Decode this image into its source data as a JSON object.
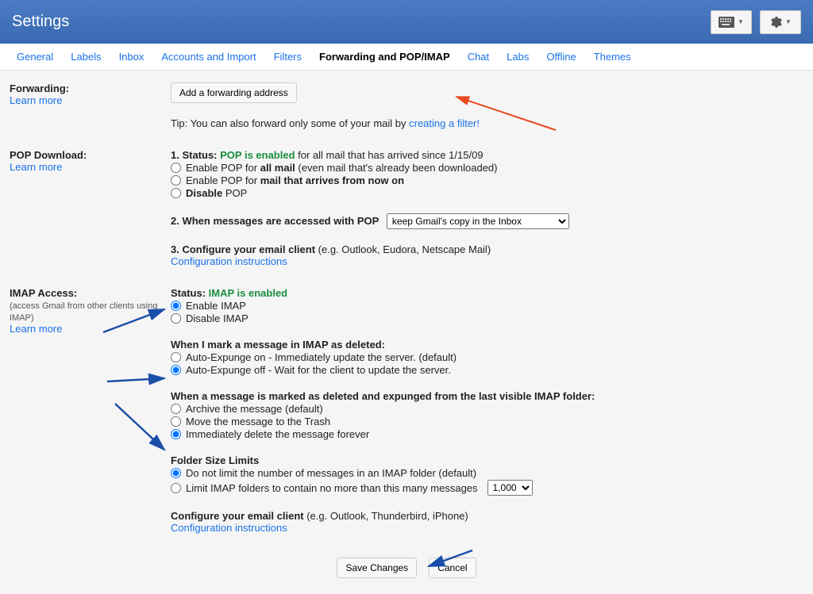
{
  "header": {
    "title": "Settings"
  },
  "tabs": [
    {
      "label": "General"
    },
    {
      "label": "Labels"
    },
    {
      "label": "Inbox"
    },
    {
      "label": "Accounts and Import"
    },
    {
      "label": "Filters"
    },
    {
      "label": "Forwarding and POP/IMAP",
      "active": true
    },
    {
      "label": "Chat"
    },
    {
      "label": "Labs"
    },
    {
      "label": "Offline"
    },
    {
      "label": "Themes"
    }
  ],
  "forwarding": {
    "label": "Forwarding:",
    "learn": "Learn more",
    "addBtn": "Add a forwarding address",
    "tipPrefix": "Tip: You can also forward only some of your mail by ",
    "tipLink": "creating a filter!"
  },
  "pop": {
    "label": "POP Download:",
    "learn": "Learn more",
    "statusPrefix": "1. Status: ",
    "statusEnabled": "POP is enabled",
    "statusSuffix": " for all mail that has arrived since 1/15/09",
    "opt1a": "Enable POP for ",
    "opt1b": "all mail",
    "opt1c": " (even mail that's already been downloaded)",
    "opt2a": "Enable POP for ",
    "opt2b": "mail that arrives from now on",
    "opt3a": "Disable",
    "opt3b": " POP",
    "accessTitle": "2. When messages are accessed with POP",
    "accessSelect": "keep Gmail's copy in the Inbox",
    "configTitle": "3. Configure your email client",
    "configSuffix": " (e.g. Outlook, Eudora, Netscape Mail)",
    "configLink": "Configuration instructions"
  },
  "imap": {
    "label": "IMAP Access:",
    "sublabel": "(access Gmail from other clients using IMAP)",
    "learn": "Learn more",
    "statusPrefix": "Status: ",
    "statusEnabled": "IMAP is enabled",
    "opt1": "Enable IMAP",
    "opt2": "Disable IMAP",
    "deletedTitle": "When I mark a message in IMAP as deleted:",
    "delOpt1": "Auto-Expunge on - Immediately update the server. (default)",
    "delOpt2": "Auto-Expunge off - Wait for the client to update the server.",
    "expungedTitle": "When a message is marked as deleted and expunged from the last visible IMAP folder:",
    "expOpt1": "Archive the message (default)",
    "expOpt2": "Move the message to the Trash",
    "expOpt3": "Immediately delete the message forever",
    "folderTitle": "Folder Size Limits",
    "folderOpt1": "Do not limit the number of messages in an IMAP folder (default)",
    "folderOpt2": "Limit IMAP folders to contain no more than this many messages",
    "folderSelect": "1,000",
    "configTitle": "Configure your email client",
    "configSuffix": " (e.g. Outlook, Thunderbird, iPhone)",
    "configLink": "Configuration instructions"
  },
  "footer": {
    "save": "Save Changes",
    "cancel": "Cancel"
  }
}
